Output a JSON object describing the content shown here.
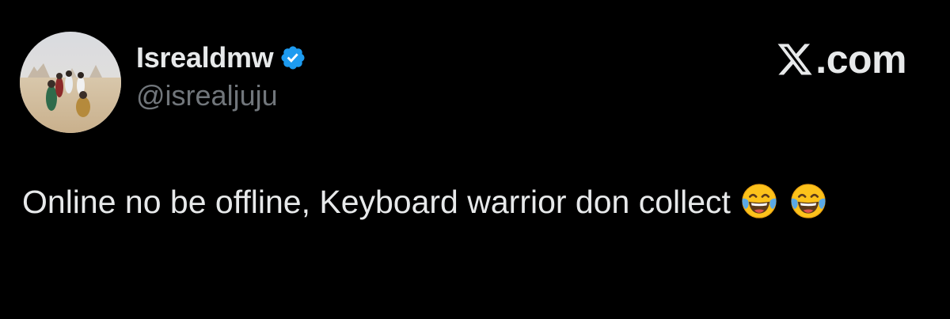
{
  "author": {
    "display_name": "Isrealdmw",
    "handle": "@isrealjuju",
    "verified": true,
    "avatar_icon": "desert-figures-avatar"
  },
  "brand": {
    "logo_icon": "x-logo-icon",
    "domain": ".com"
  },
  "tweet": {
    "text": "Online no be offline, Keyboard warrior don collect",
    "emojis": [
      "face-with-tears-of-joy",
      "face-with-tears-of-joy"
    ]
  },
  "colors": {
    "background": "#000000",
    "primary_text": "#e7e9ea",
    "secondary_text": "#71767b",
    "verified_badge": "#1d9bf0"
  }
}
